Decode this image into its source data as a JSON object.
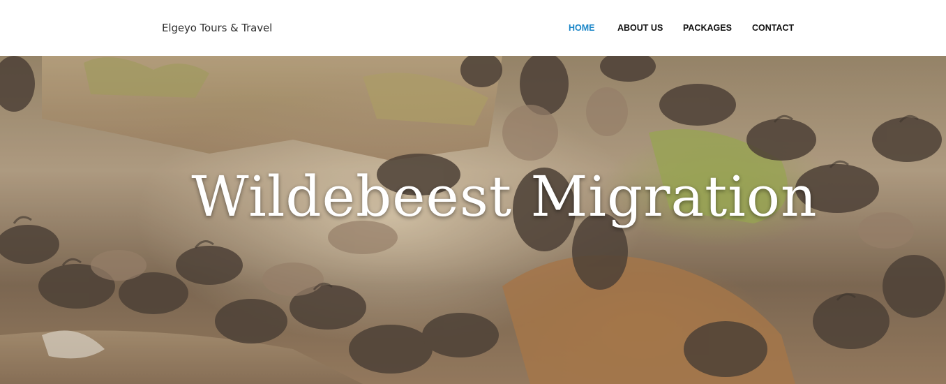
{
  "brand": {
    "name": "Elgeyo Tours & Travel"
  },
  "nav": {
    "items": [
      {
        "label": "HOME",
        "active": true
      },
      {
        "label": "ABOUT US",
        "active": false
      },
      {
        "label": "PACKAGES",
        "active": false
      },
      {
        "label": "CONTACT",
        "active": false
      }
    ]
  },
  "hero": {
    "title": "Wildebeest Migration",
    "image_description_icon": "wildebeest-herd-photo"
  },
  "colors": {
    "nav_active": "#1a86c8",
    "nav_default": "#111111",
    "hero_title": "#ffffff",
    "header_bg": "#ffffff"
  }
}
